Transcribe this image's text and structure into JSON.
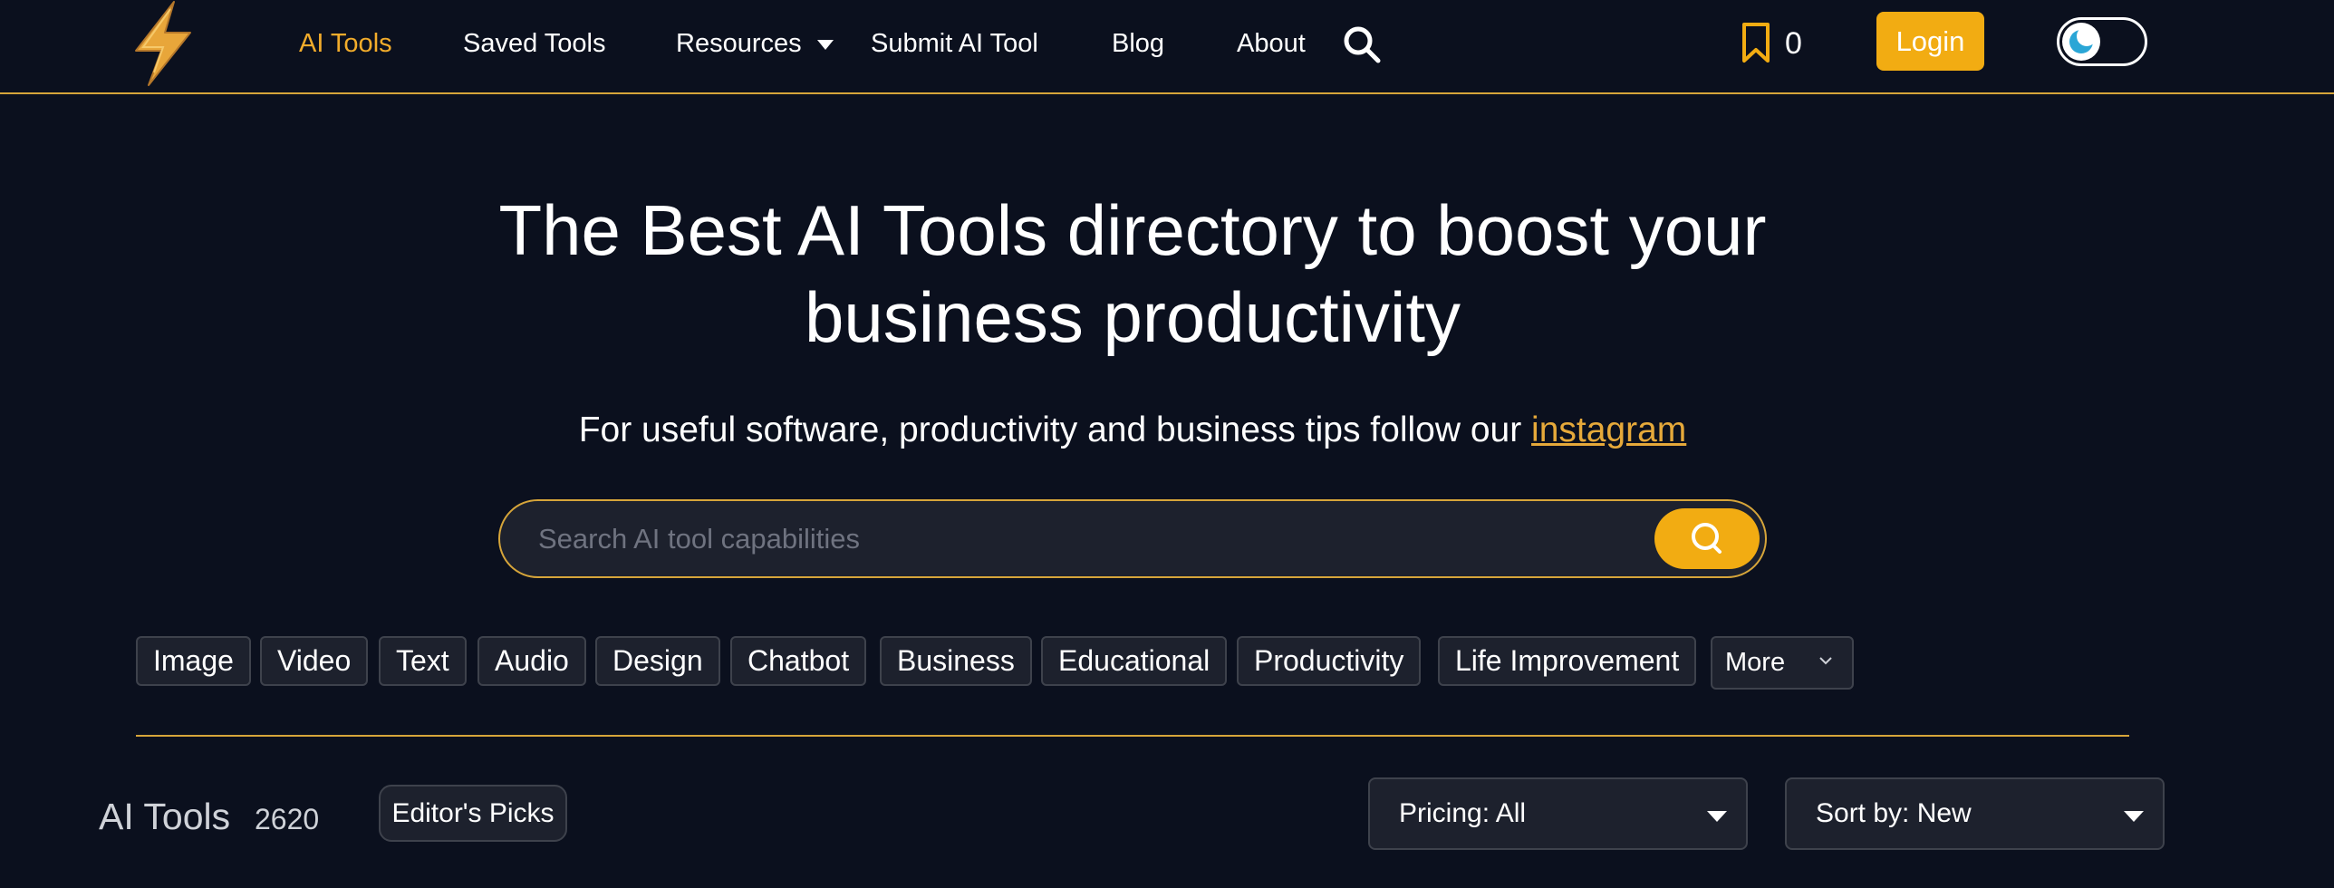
{
  "header": {
    "nav": [
      {
        "label": "AI Tools",
        "active": true
      },
      {
        "label": "Saved Tools"
      },
      {
        "label": "Resources"
      },
      {
        "label": "Submit AI Tool"
      },
      {
        "label": "Blog"
      },
      {
        "label": "About"
      }
    ],
    "saved_count": "0",
    "login_label": "Login",
    "theme": "dark"
  },
  "hero": {
    "title_line1": "The Best AI Tools directory to boost your",
    "title_line2": "business productivity",
    "subtitle_prefix": "For useful software, productivity and business tips follow our ",
    "subtitle_link": "instagram"
  },
  "search": {
    "placeholder": "Search AI tool capabilities",
    "value": ""
  },
  "categories": [
    "Image",
    "Video",
    "Text",
    "Audio",
    "Design",
    "Chatbot",
    "Business",
    "Educational",
    "Productivity",
    "Life Improvement"
  ],
  "more_label": "More",
  "tools": {
    "title": "AI Tools",
    "count": "2620",
    "editors_label": "Editor's Picks",
    "pricing_label": "Pricing: All",
    "sort_label": "Sort by: New"
  },
  "colors": {
    "background": "#0b101e",
    "accent": "#f2ac12",
    "accent_line": "#d6a53a",
    "chip_bg": "#1d212d",
    "chip_border": "#3e424c"
  },
  "icons": {
    "logo": "lightning-bolt-icon",
    "search": "search-icon",
    "saved": "bookmark-icon",
    "theme": "moon-icon",
    "dropdown": "chevron-down-icon"
  }
}
